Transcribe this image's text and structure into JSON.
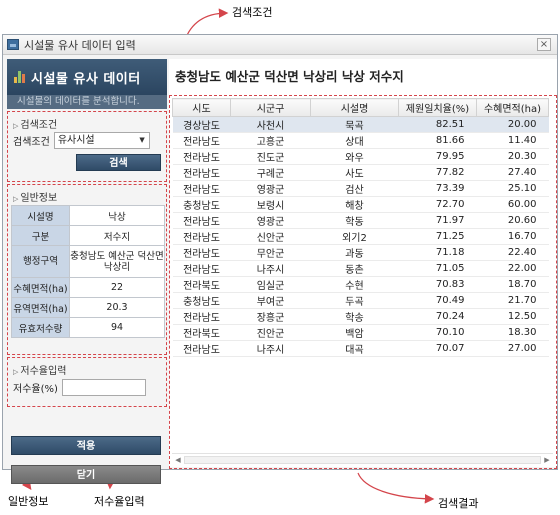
{
  "annotations": {
    "search_condition": "검색조건",
    "general_info": "일반정보",
    "rate_input": "저수율입력",
    "search_result": "검색결과"
  },
  "window": {
    "title": "시설물 유사 데이터 입력",
    "close_glyph": "×"
  },
  "header": {
    "title": "시설물 유사 데이터",
    "subtitle": "시설물의 데이터를 분석합니다."
  },
  "search": {
    "section_label": "검색조건",
    "field_label": "검색조건",
    "selected": "유사시설",
    "button": "검색"
  },
  "info": {
    "section_label": "일반정보",
    "rows": [
      {
        "key": "시설명",
        "value": "낙상"
      },
      {
        "key": "구분",
        "value": "저수지"
      },
      {
        "key": "행정구역",
        "value": "충청남도 예산군 덕산면 낙상리"
      },
      {
        "key": "수혜면적(ha)",
        "value": "22"
      },
      {
        "key": "유역면적(ha)",
        "value": "20.3"
      },
      {
        "key": "유효저수량",
        "value": "94"
      }
    ]
  },
  "rate": {
    "section_label": "저수율입력",
    "field_label": "저수율(%)",
    "value": ""
  },
  "buttons": {
    "apply": "적용",
    "close": "닫기"
  },
  "result": {
    "title": "충청남도 예산군 덕산면 낙상리 낙상 저수지",
    "columns": [
      "시도",
      "시군구",
      "시설명",
      "제원일치율(%)",
      "수혜면적(ha)"
    ],
    "rows": [
      [
        "경상남도",
        "사천시",
        "묵곡",
        "82.51",
        "20.00"
      ],
      [
        "전라남도",
        "고흥군",
        "상대",
        "81.66",
        "11.40"
      ],
      [
        "전라남도",
        "진도군",
        "와우",
        "79.95",
        "20.30"
      ],
      [
        "전라남도",
        "구례군",
        "사도",
        "77.82",
        "27.40"
      ],
      [
        "전라남도",
        "영광군",
        "검산",
        "73.39",
        "25.10"
      ],
      [
        "충청남도",
        "보령시",
        "해창",
        "72.70",
        "60.00"
      ],
      [
        "전라남도",
        "영광군",
        "학동",
        "71.97",
        "20.60"
      ],
      [
        "전라남도",
        "신안군",
        "외기2",
        "71.25",
        "16.70"
      ],
      [
        "전라남도",
        "무안군",
        "과동",
        "71.18",
        "22.40"
      ],
      [
        "전라남도",
        "나주시",
        "동촌",
        "71.05",
        "22.00"
      ],
      [
        "전라북도",
        "임실군",
        "수현",
        "70.83",
        "18.70"
      ],
      [
        "충청남도",
        "부여군",
        "두곡",
        "70.49",
        "21.70"
      ],
      [
        "전라남도",
        "장흥군",
        "학송",
        "70.24",
        "12.50"
      ],
      [
        "전라북도",
        "진안군",
        "백암",
        "70.10",
        "18.30"
      ],
      [
        "전라남도",
        "나주시",
        "대곡",
        "70.07",
        "27.00"
      ]
    ]
  },
  "colors": {
    "banner": "#2b4560",
    "accent_border": "#d4454b",
    "key_cell": "#c9d6e6",
    "selected_row": "#dfe6ef",
    "bar_icon": [
      "#e8b84a",
      "#8fc46a",
      "#e07a4a"
    ]
  }
}
